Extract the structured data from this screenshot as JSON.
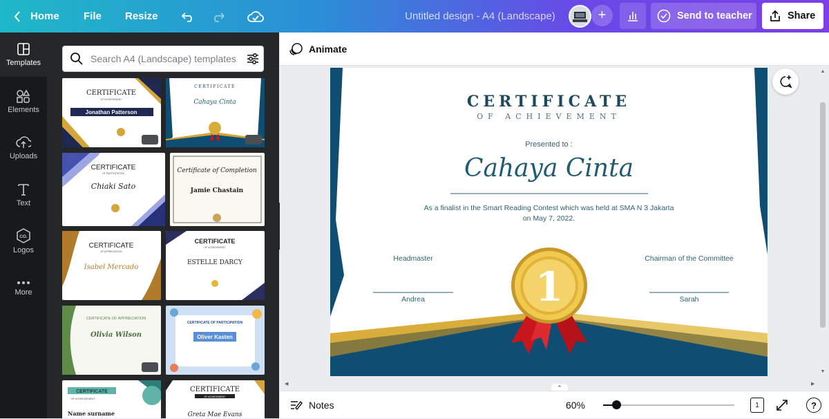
{
  "topbar": {
    "home_label": "Home",
    "file_label": "File",
    "resize_label": "Resize",
    "design_title": "Untitled design - A4 (Landscape)",
    "send_label": "Send to teacher",
    "share_label": "Share"
  },
  "rail": {
    "items": [
      {
        "label": "Templates",
        "icon": "templates-icon"
      },
      {
        "label": "Elements",
        "icon": "elements-icon"
      },
      {
        "label": "Uploads",
        "icon": "uploads-icon"
      },
      {
        "label": "Text",
        "icon": "text-icon"
      },
      {
        "label": "Logos",
        "icon": "logos-icon"
      },
      {
        "label": "More",
        "icon": "more-icon"
      }
    ]
  },
  "search": {
    "placeholder": "Search A4 (Landscape) templates"
  },
  "templates": [
    {
      "heading": "CERTIFICATE",
      "sub": "OF ACHIEVEMENT",
      "name": "Jonathan Patterson"
    },
    {
      "heading": "CERTIFICATE",
      "sub": "OF ACHIEVEMENT",
      "name": "Cahaya Cinta"
    },
    {
      "heading": "CERTIFICATE",
      "sub": "OF PARTICIPATION",
      "name": "Chiaki Sato"
    },
    {
      "heading": "Certificate of Completion",
      "sub": "",
      "name": "Jamie Chastain"
    },
    {
      "heading": "CERTIFICATE",
      "sub": "OF APPRECIATION",
      "name": "Isabel Mercado"
    },
    {
      "heading": "CERTIFICATE",
      "sub": "OF ACHIEVEMENT",
      "name": "ESTELLE DARCY"
    },
    {
      "heading": "CERTIFICATE OF APPRECIATION",
      "sub": "",
      "name": "Olivia Wilson"
    },
    {
      "heading": "CERTIFICATE OF PARTICIPATION",
      "sub": "",
      "name": "Oliver Kasten"
    },
    {
      "heading": "CERTIFICATE",
      "sub": "OF ACHIEVEMENT",
      "name": "Name surname"
    },
    {
      "heading": "CERTIFICATE",
      "sub": "OF ACHIEVEMENT",
      "name": "Greta Mae Evans"
    }
  ],
  "editor": {
    "animate_label": "Animate"
  },
  "certificate": {
    "title": "CERTIFICATE",
    "subtitle": "OF ACHIEVEMENT",
    "presented": "Presented to :",
    "recipient": "Cahaya Cinta",
    "description": "As a finalist in the Smart Reading Contest which was held at SMA N 3 Jakarta on May 7, 2022.",
    "left_role": "Headmaster",
    "left_name": "Andrea",
    "right_role": "Chairman of the Committee",
    "right_name": "Sarah",
    "medal_number": "1"
  },
  "bottombar": {
    "notes_label": "Notes",
    "zoom_label": "60%",
    "zoom_fraction": 0.1,
    "page_count": "1"
  },
  "colors": {
    "navy": "#0f4d72",
    "gold": "#d9ad3c",
    "ribbon": "#c8161d",
    "panel": "#252627",
    "rail": "#18191b"
  }
}
